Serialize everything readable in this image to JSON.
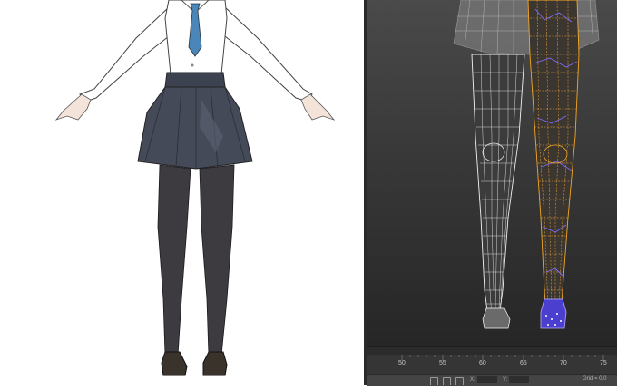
{
  "timeline": {
    "ticks": [
      "50",
      "55",
      "60",
      "65",
      "70",
      "75"
    ]
  },
  "statusbar": {
    "x_label": "X:",
    "y_label": "Y:",
    "grid_label": "Grid = 0.0"
  },
  "icons": {
    "lock": "lock-icon",
    "select": "select-icon",
    "move": "move-icon",
    "absolute": "absolute-mode-icon"
  }
}
